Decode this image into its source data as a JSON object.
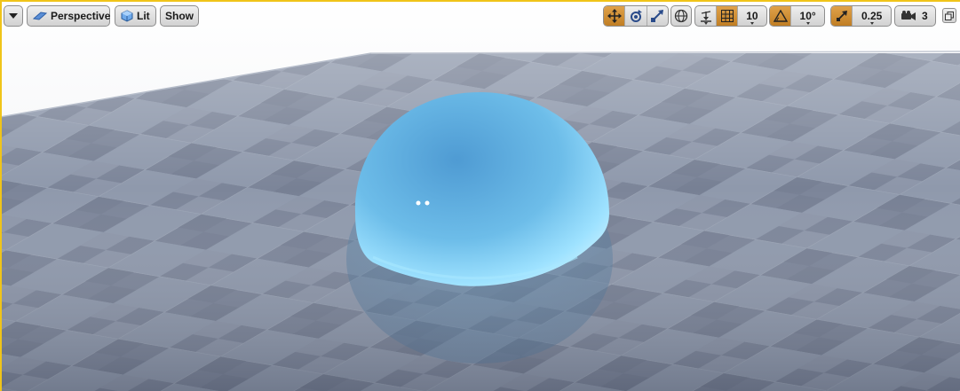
{
  "toolbar": {
    "menu_icon": "chevron-down-icon",
    "perspective_label": "Perspective",
    "lit_label": "Lit",
    "show_label": "Show",
    "grid_snap_value": "10",
    "rotation_snap_value": "10°",
    "scale_snap_value": "0.25",
    "camera_speed_value": "3"
  },
  "colors": {
    "accent": "#f0c419",
    "active_toggle": "#d69438",
    "sky": "#f2f3f6",
    "floor_light": "#8d97ab",
    "floor_dark": "#6b7488",
    "sphere": "#6ec3ec"
  }
}
